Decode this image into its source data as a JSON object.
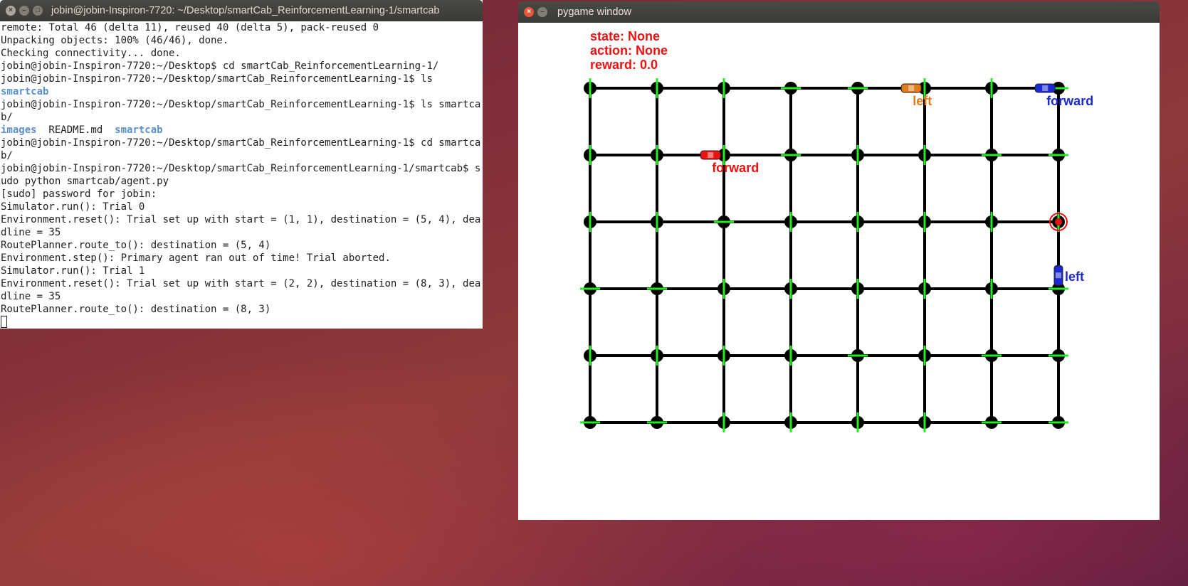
{
  "terminal": {
    "title": "jobin@jobin-Inspiron-7720: ~/Desktop/smartCab_ReinforcementLearning-1/smartcab",
    "lines": [
      [
        {
          "text": "remote: Total 46 (delta 11), reused 40 (delta 5), pack-reused 0"
        }
      ],
      [
        {
          "text": "Unpacking objects: 100% (46/46), done."
        }
      ],
      [
        {
          "text": "Checking connectivity... done."
        }
      ],
      [
        {
          "text": "jobin@jobin-Inspiron-7720:~/Desktop$ cd smartCab_ReinforcementLearning-1/"
        }
      ],
      [
        {
          "text": "jobin@jobin-Inspiron-7720:~/Desktop/smartCab_ReinforcementLearning-1$ ls"
        }
      ],
      [
        {
          "text": "smartcab",
          "style": "blue"
        }
      ],
      [
        {
          "text": "jobin@jobin-Inspiron-7720:~/Desktop/smartCab_ReinforcementLearning-1$ ls smartca"
        }
      ],
      [
        {
          "text": "b/"
        }
      ],
      [
        {
          "text": "images",
          "style": "blue"
        },
        {
          "text": "  README.md  "
        },
        {
          "text": "smartcab",
          "style": "blue"
        }
      ],
      [
        {
          "text": "jobin@jobin-Inspiron-7720:~/Desktop/smartCab_ReinforcementLearning-1$ cd smartca"
        }
      ],
      [
        {
          "text": "b/"
        }
      ],
      [
        {
          "text": "jobin@jobin-Inspiron-7720:~/Desktop/smartCab_ReinforcementLearning-1/smartcab$ s"
        }
      ],
      [
        {
          "text": "udo python smartcab/agent.py"
        }
      ],
      [
        {
          "text": "[sudo] password for jobin:"
        }
      ],
      [
        {
          "text": "Simulator.run(): Trial 0"
        }
      ],
      [
        {
          "text": "Environment.reset(): Trial set up with start = (1, 1), destination = (5, 4), dea"
        }
      ],
      [
        {
          "text": "dline = 35"
        }
      ],
      [
        {
          "text": "RoutePlanner.route_to(): destination = (5, 4)"
        }
      ],
      [
        {
          "text": "Environment.step(): Primary agent ran out of time! Trial aborted."
        }
      ],
      [
        {
          "text": "Simulator.run(): Trial 1"
        }
      ],
      [
        {
          "text": "Environment.reset(): Trial set up with start = (2, 2), destination = (8, 3), dea"
        }
      ],
      [
        {
          "text": "dline = 35"
        }
      ],
      [
        {
          "text": "RoutePlanner.route_to(): destination = (8, 3)"
        }
      ]
    ]
  },
  "pygame": {
    "title": "pygame window",
    "hud": {
      "state": "state: None",
      "action": "action: None",
      "reward": "reward: 0.0"
    },
    "grid": {
      "columns": 8,
      "rows": 6,
      "road_color": "#000000",
      "light_color": "#22ee22"
    },
    "lights": [
      [
        "ns",
        "ns",
        "ns",
        "ew",
        "ew",
        "ns",
        "ns",
        "ew"
      ],
      [
        "ns",
        "ns",
        "ns",
        "ew",
        "ns",
        "ns",
        "ew",
        "ew"
      ],
      [
        "ns",
        "ns",
        "ew",
        "ns",
        "ns",
        "ns",
        "ns",
        "ns"
      ],
      [
        "ew",
        "ew",
        "ns",
        "ns",
        "ns",
        "ns",
        "ns",
        "ew"
      ],
      [
        "ns",
        "ns",
        "ns",
        "ns",
        "ew",
        "ns",
        "ew",
        "ew"
      ],
      [
        "ew",
        "ew",
        "ns",
        "ns",
        "ns",
        "ns",
        "ew",
        "ew"
      ]
    ],
    "destination": {
      "col": 8,
      "row": 3,
      "color": "#ee1111"
    },
    "cars": [
      {
        "col": 5.8,
        "row": 1,
        "orient": "h",
        "color": "#e07a1a",
        "label": "left"
      },
      {
        "col": 7.8,
        "row": 1,
        "orient": "h",
        "color": "#1a2ad0",
        "label": "forward"
      },
      {
        "col": 2.8,
        "row": 2,
        "orient": "h",
        "color": "#ee1111",
        "label": "forward"
      },
      {
        "col": 8,
        "row": 3.8,
        "orient": "v",
        "color": "#1a2ad0",
        "label": "left"
      }
    ]
  }
}
